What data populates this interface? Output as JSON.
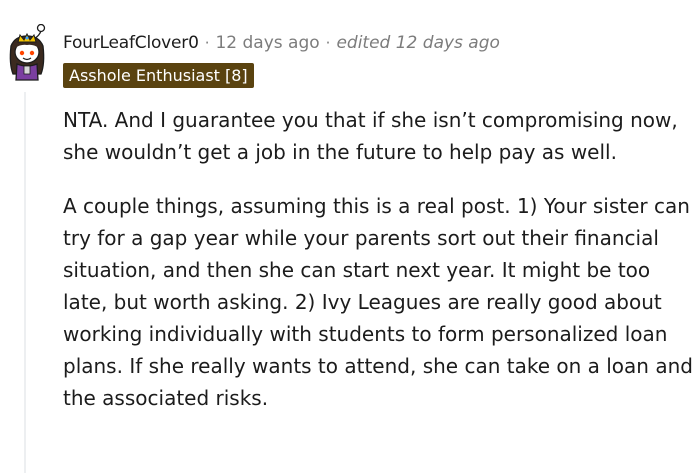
{
  "comment": {
    "username": "FourLeafClover0",
    "separator_1": "·",
    "time": "12 days ago",
    "separator_2": "·",
    "edited": "edited 12 days ago",
    "flair": "Asshole Enthusiast [8]",
    "paragraphs": [
      "NTA. And I guarantee you that if she isn’t compromising now, she wouldn’t get a job in the future to help pay as well.",
      "A couple things, assuming this is a real post. 1) Your sister can try for a gap year while your parents sort out their financial situation, and then she can start next year. It might be too late, but worth asking. 2) Ivy Leagues are really good about working individually with students to form personalized loan plans. If she really wants to attend, she can take on a loan and the associated risks."
    ]
  },
  "colors": {
    "flair_background": "#5a4310",
    "flair_text": "#ffffff",
    "meta_text": "#7c7c7c",
    "body_text": "#1c1c1c",
    "thread_line": "#edeff1"
  },
  "icons": {
    "avatar": "snoo-avatar-icon"
  }
}
